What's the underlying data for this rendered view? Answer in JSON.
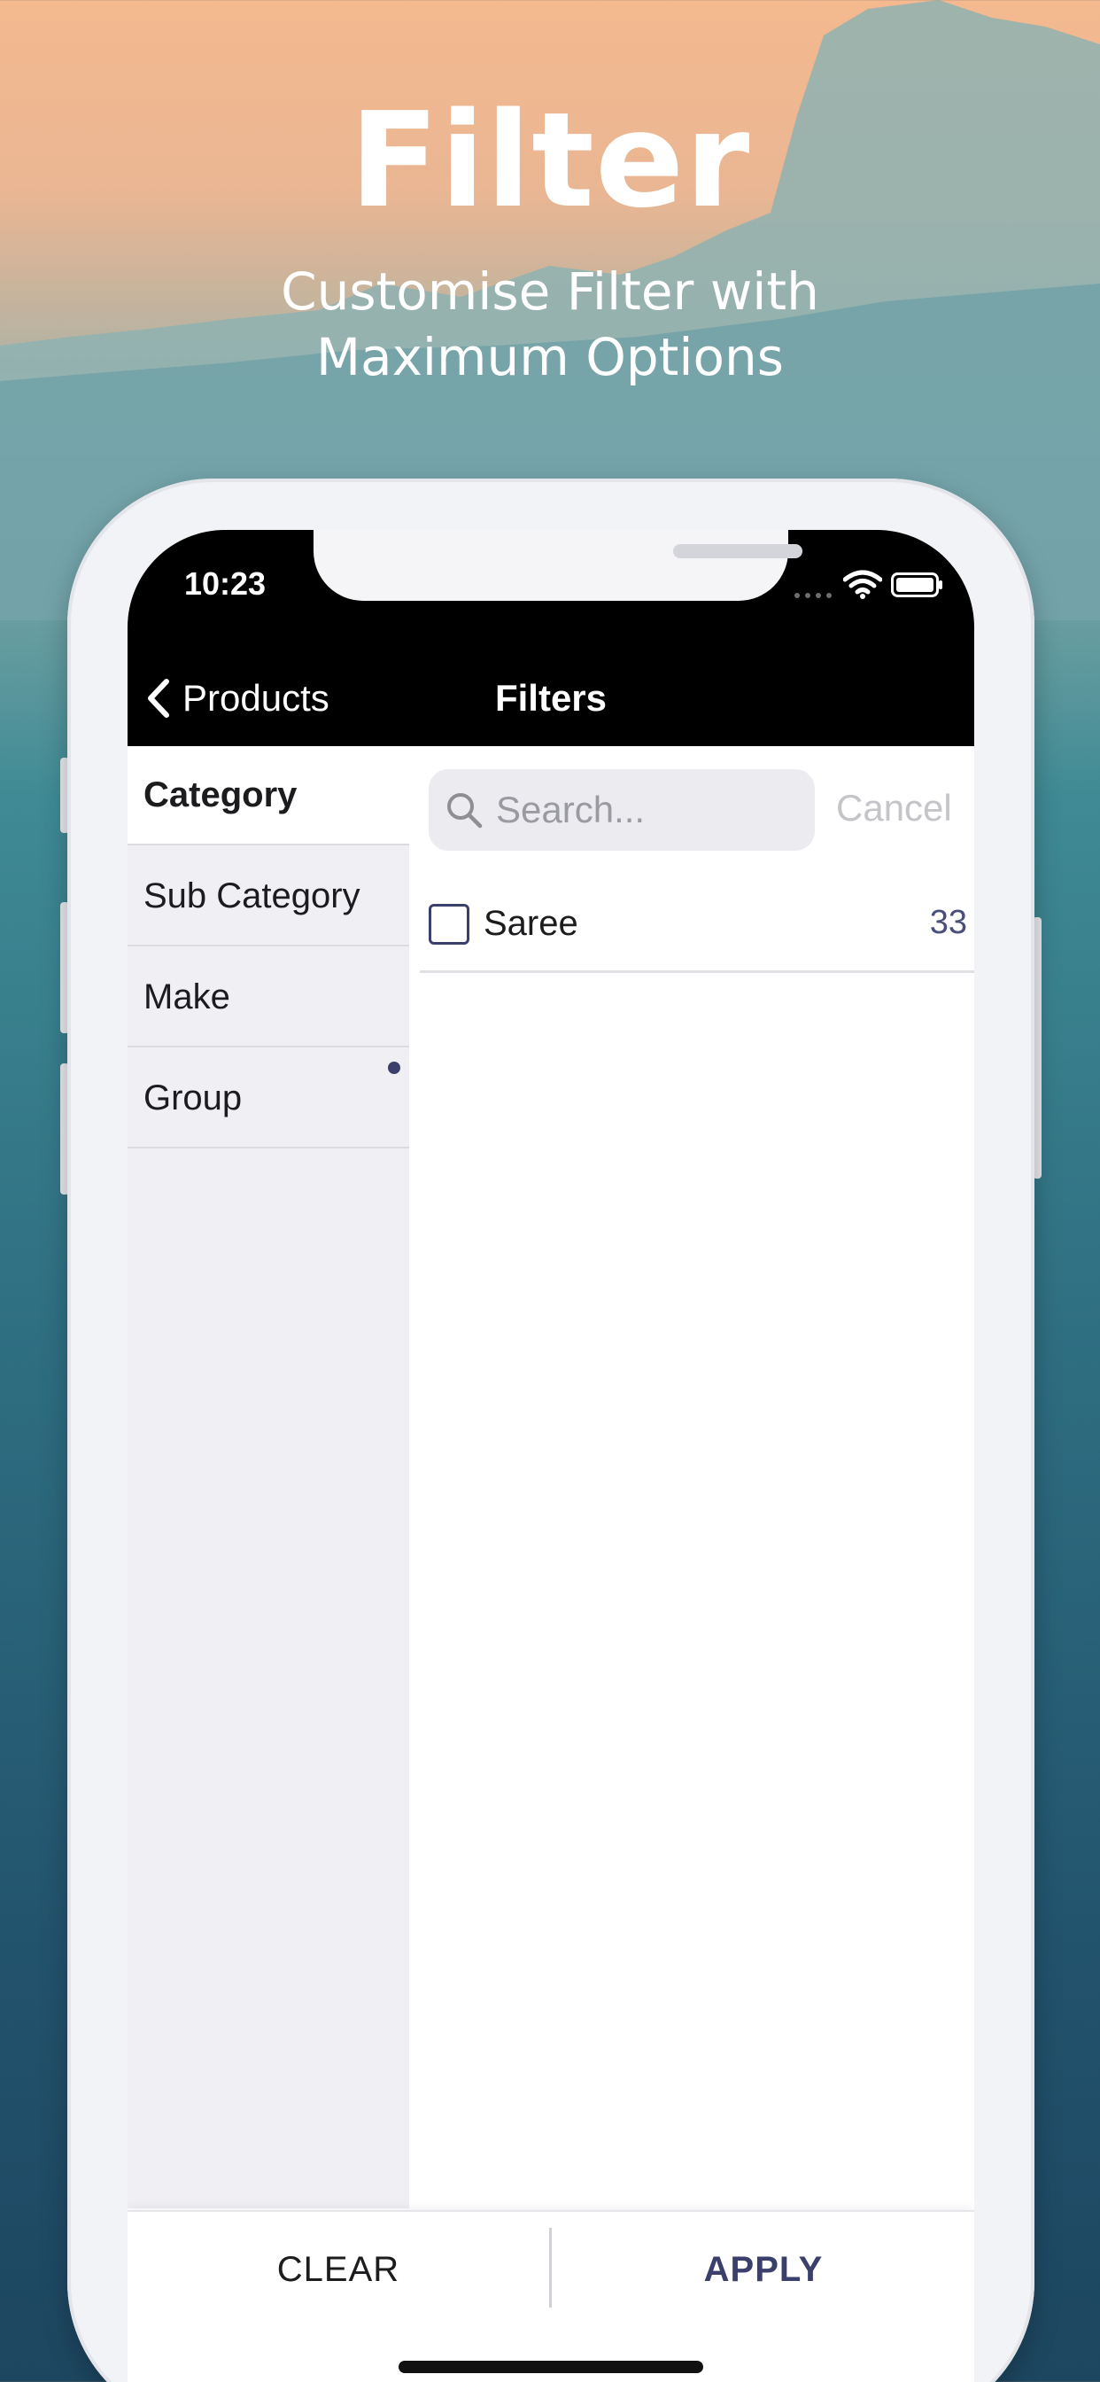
{
  "promo": {
    "title": "Filter",
    "subtitle": "Customise Filter with Maximum Options"
  },
  "status_bar": {
    "time": "10:23",
    "icons": [
      "signal-icon",
      "wifi-icon",
      "battery-icon"
    ]
  },
  "nav": {
    "back_label": "Products",
    "title": "Filters"
  },
  "sidebar": {
    "items": [
      {
        "label": "Category",
        "active": true
      },
      {
        "label": "Sub Category",
        "active": false
      },
      {
        "label": "Make",
        "active": false
      },
      {
        "label": "Group",
        "active": false,
        "has_indicator": true
      }
    ]
  },
  "search": {
    "placeholder": "Search...",
    "cancel_label": "Cancel"
  },
  "options": [
    {
      "label": "Saree",
      "count": "33",
      "checked": false
    }
  ],
  "footer": {
    "clear_label": "CLEAR",
    "apply_label": "APPLY"
  },
  "colors": {
    "accent": "#3a3f6b",
    "nav_background": "#000000",
    "sidebar_background": "#f0eff4"
  }
}
